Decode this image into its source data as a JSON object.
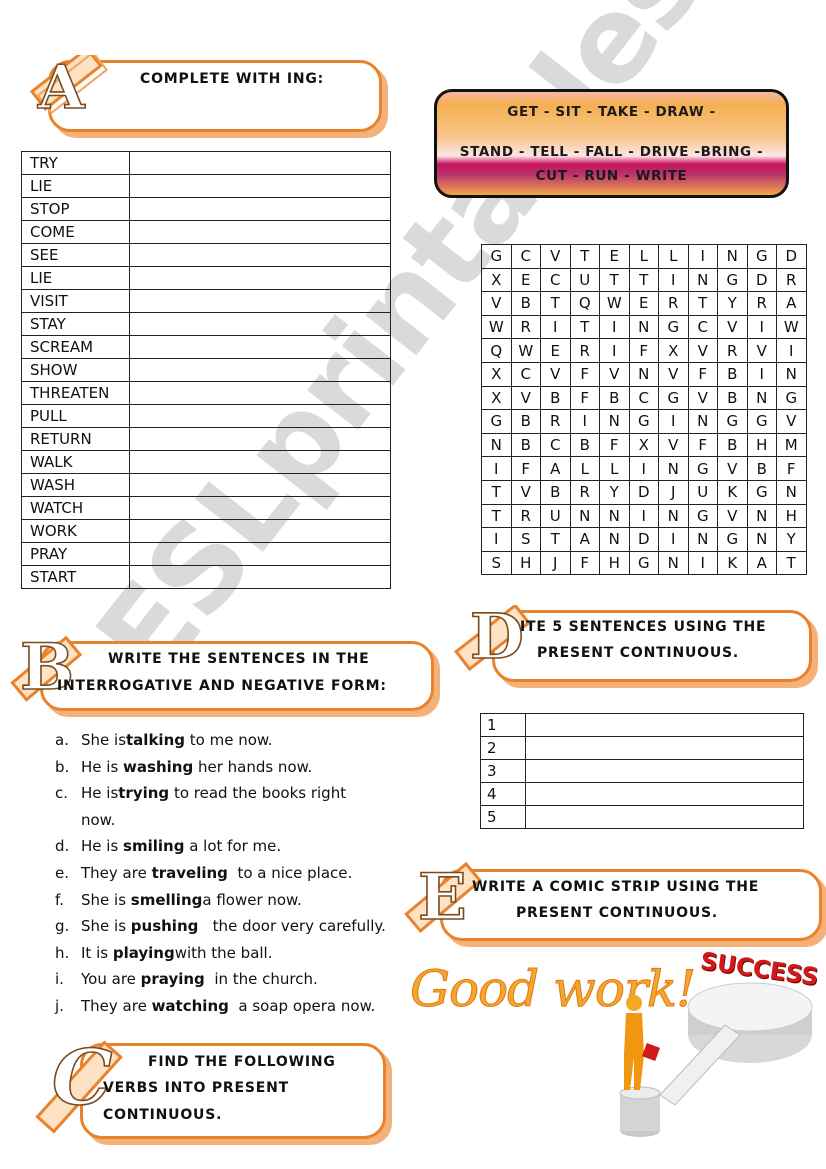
{
  "section_a": {
    "letter": "A",
    "title": "COMPLETE WITH ING:",
    "verbs": [
      "TRY",
      "LIE",
      "STOP",
      "COME",
      "SEE",
      "LIE",
      "VISIT",
      "STAY",
      "SCREAM",
      "SHOW",
      "THREATEN",
      "PULL",
      "RETURN",
      "WALK",
      "WASH",
      "WATCH",
      "WORK",
      "PRAY",
      "START"
    ]
  },
  "verb_box": {
    "line1": "GET - SIT - TAKE - DRAW -",
    "line2": "STAND - TELL - FALL - DRIVE -BRING -",
    "line3": "CUT - RUN - WRITE"
  },
  "word_search": {
    "rows": [
      [
        "G",
        "C",
        "V",
        "T",
        "E",
        "L",
        "L",
        "I",
        "N",
        "G",
        "D"
      ],
      [
        "X",
        "E",
        "C",
        "U",
        "T",
        "T",
        "I",
        "N",
        "G",
        "D",
        "R"
      ],
      [
        "V",
        "B",
        "T",
        "Q",
        "W",
        "E",
        "R",
        "T",
        "Y",
        "R",
        "A"
      ],
      [
        "W",
        "R",
        "I",
        "T",
        "I",
        "N",
        "G",
        "C",
        "V",
        "I",
        "W"
      ],
      [
        "Q",
        "W",
        "E",
        "R",
        "I",
        "F",
        "X",
        "V",
        "R",
        "V",
        "I"
      ],
      [
        "X",
        "C",
        "V",
        "F",
        "V",
        "N",
        "V",
        "F",
        "B",
        "I",
        "N"
      ],
      [
        "X",
        "V",
        "B",
        "F",
        "B",
        "C",
        "G",
        "V",
        "B",
        "N",
        "G"
      ],
      [
        "G",
        "B",
        "R",
        "I",
        "N",
        "G",
        "I",
        "N",
        "G",
        "G",
        "V"
      ],
      [
        "N",
        "B",
        "C",
        "B",
        "F",
        "X",
        "V",
        "F",
        "B",
        "H",
        "M"
      ],
      [
        "I",
        "F",
        "A",
        "L",
        "L",
        "I",
        "N",
        "G",
        "V",
        "B",
        "F"
      ],
      [
        "T",
        "V",
        "B",
        "R",
        "Y",
        "D",
        "J",
        "U",
        "K",
        "G",
        "N"
      ],
      [
        "T",
        "R",
        "U",
        "N",
        "N",
        "I",
        "N",
        "G",
        "V",
        "N",
        "H"
      ],
      [
        "I",
        "S",
        "T",
        "A",
        "N",
        "D",
        "I",
        "N",
        "G",
        "N",
        "Y"
      ],
      [
        "S",
        "H",
        "J",
        "F",
        "H",
        "G",
        "N",
        "I",
        "K",
        "A",
        "T"
      ]
    ]
  },
  "section_b": {
    "letter": "B",
    "title_line1": "WRITE THE SENTENCES IN THE",
    "title_line2": "INTERROGATIVE AND NEGATIVE FORM:",
    "sentences": [
      {
        "label": "a.",
        "before": "She is",
        "verb": "talking",
        "after": " to me now."
      },
      {
        "label": "b.",
        "before": "He is ",
        "verb": "washing",
        "after": " her hands now."
      },
      {
        "label": "c.",
        "before": "He is",
        "verb": "trying",
        "after": " to read the books right"
      },
      {
        "label": "",
        "before": "now.",
        "verb": "",
        "after": ""
      },
      {
        "label": "d.",
        "before": "He is ",
        "verb": "smiling",
        "after": " a lot for me."
      },
      {
        "label": "e.",
        "before": "They are ",
        "verb": "traveling",
        "after": "  to a nice place."
      },
      {
        "label": "f.",
        "before": "She is ",
        "verb": "smelling",
        "after": "a flower now."
      },
      {
        "label": "g.",
        "before": "She is ",
        "verb": "pushing",
        "after": "   the door very carefully."
      },
      {
        "label": "h.",
        "before": "It is ",
        "verb": "playing",
        "after": "with the ball."
      },
      {
        "label": "i.",
        "before": "You are ",
        "verb": "praying",
        "after": "  in the church."
      },
      {
        "label": "j.",
        "before": "They are ",
        "verb": "watching",
        "after": "  a soap opera now."
      }
    ]
  },
  "section_c": {
    "letter": "C",
    "title_line1": "FIND THE FOLLOWING",
    "title_line2": "VERBS INTO PRESENT",
    "title_line3": "CONTINUOUS."
  },
  "section_d": {
    "letter": "D",
    "title_line1": "ITE 5 SENTENCES USING THE",
    "title_line2": "PRESENT CONTINUOUS.",
    "numbers": [
      "1",
      "2",
      "3",
      "4",
      "5"
    ]
  },
  "section_e": {
    "letter": "E",
    "title_line1": "WRITE A COMIC STRIP USING THE",
    "title_line2": "PRESENT CONTINUOUS."
  },
  "footer": {
    "good_work": "Good work!",
    "success": "SUCCESS"
  },
  "watermark": "ESLprintables.com",
  "colors": {
    "banner_border": "#e9822d",
    "banner_shadow": "#f4b27a",
    "good_work": "#f4a72e",
    "success": "#d01a1a"
  }
}
